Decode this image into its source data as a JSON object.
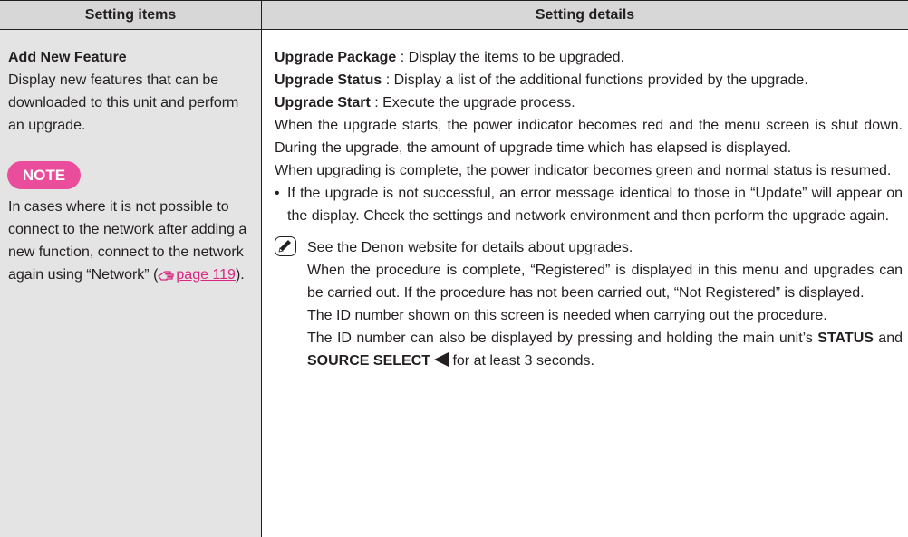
{
  "header": {
    "left": "Setting items",
    "right": "Setting details"
  },
  "left": {
    "title": "Add New Feature",
    "description": "Display new features that can be downloaded to this unit and perform an upgrade.",
    "note_label": "NOTE",
    "note_text_1": "In cases where it is not possible to connect to the network after adding a new function, connect to the network again using “Network” (",
    "note_link": "page 119",
    "note_text_2": ")."
  },
  "right": {
    "pkg_label": "Upgrade Package",
    "pkg_text": " : Display the items to be upgraded.",
    "status_label": "Upgrade Status",
    "status_text": " : Display a list of the additional functions provided by the upgrade.",
    "start_label": "Upgrade Start",
    "start_text": " : Execute the upgrade process.",
    "para1": "When the upgrade starts, the power indicator becomes red and the menu screen is shut down. During the upgrade, the amount of upgrade time which has elapsed is displayed.",
    "para2": "When upgrading is complete, the power indicator becomes green and normal status is resumed.",
    "bullet_dot": "•",
    "bullet1": "If the upgrade is not successful, an error message identical to those in “Update” will appear on the display. Check the settings and network environment and then perform the upgrade again.",
    "tip_line": "See the Denon website for details about upgrades.",
    "tip_p1": "When the procedure is complete, “Registered” is displayed in this menu and upgrades can be carried out. If the procedure has not been carried out, “Not Registered” is displayed.",
    "tip_p2": "The ID number shown on this screen is needed when carrying out the procedure.",
    "tip_p3a": "The ID number can also be displayed by pressing and holding the main unit’s ",
    "tip_status": "STATUS",
    "tip_p3b": " and ",
    "tip_source": "SOURCE SELECT",
    "tip_p3c": " for at least 3 seconds."
  },
  "colors": {
    "header_bg": "#d7d7d7",
    "left_bg": "#e4e4e4",
    "note_badge": "#ea4d9b",
    "link": "#d9267f"
  },
  "icons": [
    "hand-pointer-icon",
    "pencil-icon",
    "left-arrow-icon"
  ]
}
